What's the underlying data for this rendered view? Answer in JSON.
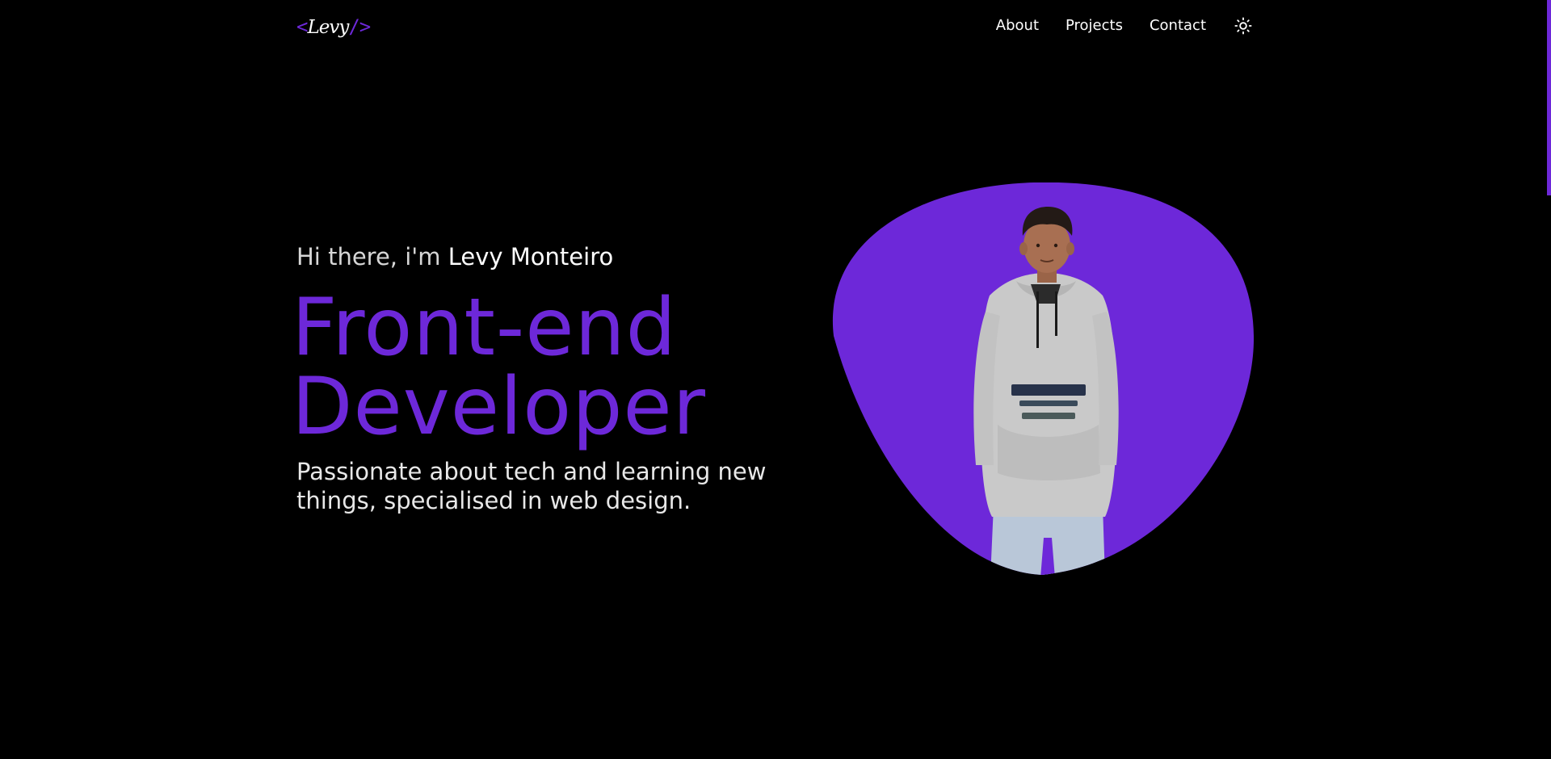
{
  "logo": {
    "open": "<",
    "name": "Levy",
    "close": "/>"
  },
  "nav": {
    "items": [
      {
        "label": "About"
      },
      {
        "label": "Projects"
      },
      {
        "label": "Contact"
      }
    ],
    "theme_icon": "sun-icon"
  },
  "hero": {
    "greeting_prefix": "Hi there, i'm ",
    "greeting_name": "Levy Monteiro",
    "headline_line1": "Front-end",
    "headline_line2": "Developer",
    "tagline": "Passionate about tech and learning new things, specialised in web design."
  },
  "colors": {
    "background": "#000000",
    "accent": "#6d28d9",
    "text": "#ffffff"
  }
}
